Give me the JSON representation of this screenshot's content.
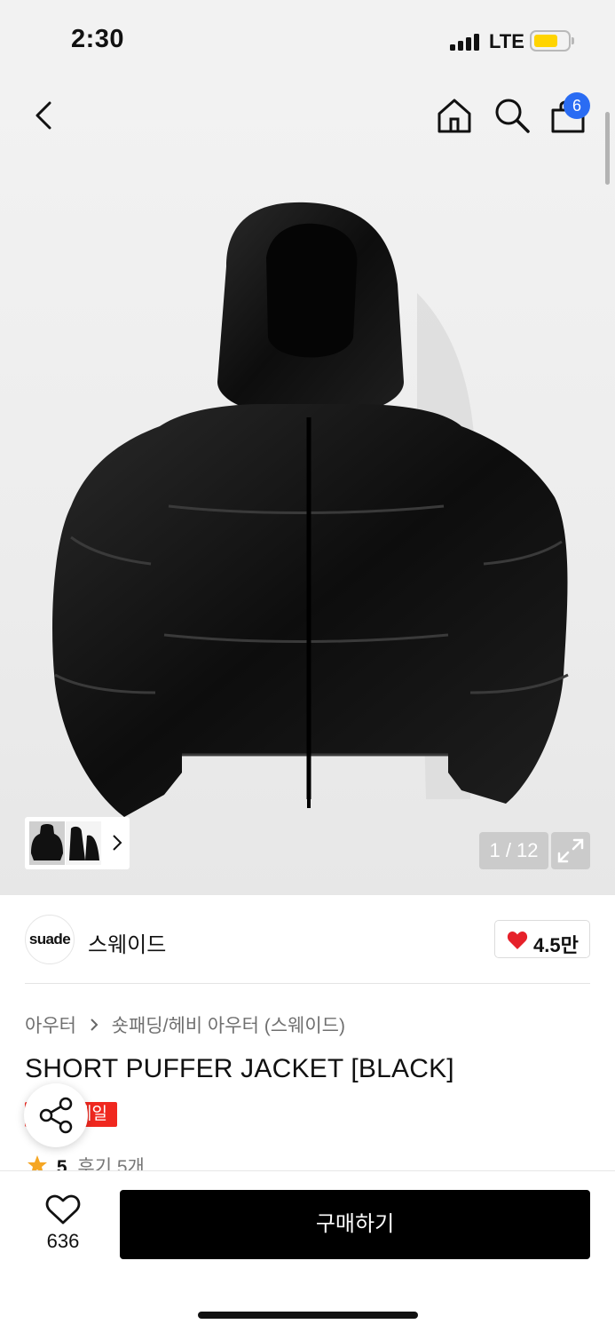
{
  "status_bar": {
    "time": "2:30",
    "network": "LTE"
  },
  "nav": {
    "back_icon": "chevron-left-icon",
    "home_icon": "home-icon",
    "search_icon": "search-icon",
    "bag_icon": "shopping-bag-icon",
    "bag_count": "6"
  },
  "gallery": {
    "counter": "1 / 12",
    "expand_icon": "expand-icon"
  },
  "brand": {
    "logo_text": "suade",
    "name": "스웨이드",
    "likes": "4.5만",
    "accent": "#e6212a"
  },
  "breadcrumb": {
    "category": "아우터",
    "subcategory": "숏패딩/헤비 아우터 (스웨이드)"
  },
  "product": {
    "title": "SHORT PUFFER JACKET [BLACK]",
    "badge": "세일",
    "rating": "5",
    "reviews": "후기 5개"
  },
  "bottom_bar": {
    "wish_count": "636",
    "buy_label": "구매하기"
  },
  "colors": {
    "buy_button": "#000000",
    "sale_badge": "#f0281f",
    "bag_badge": "#2a6cf3",
    "star": "#f5a623"
  }
}
